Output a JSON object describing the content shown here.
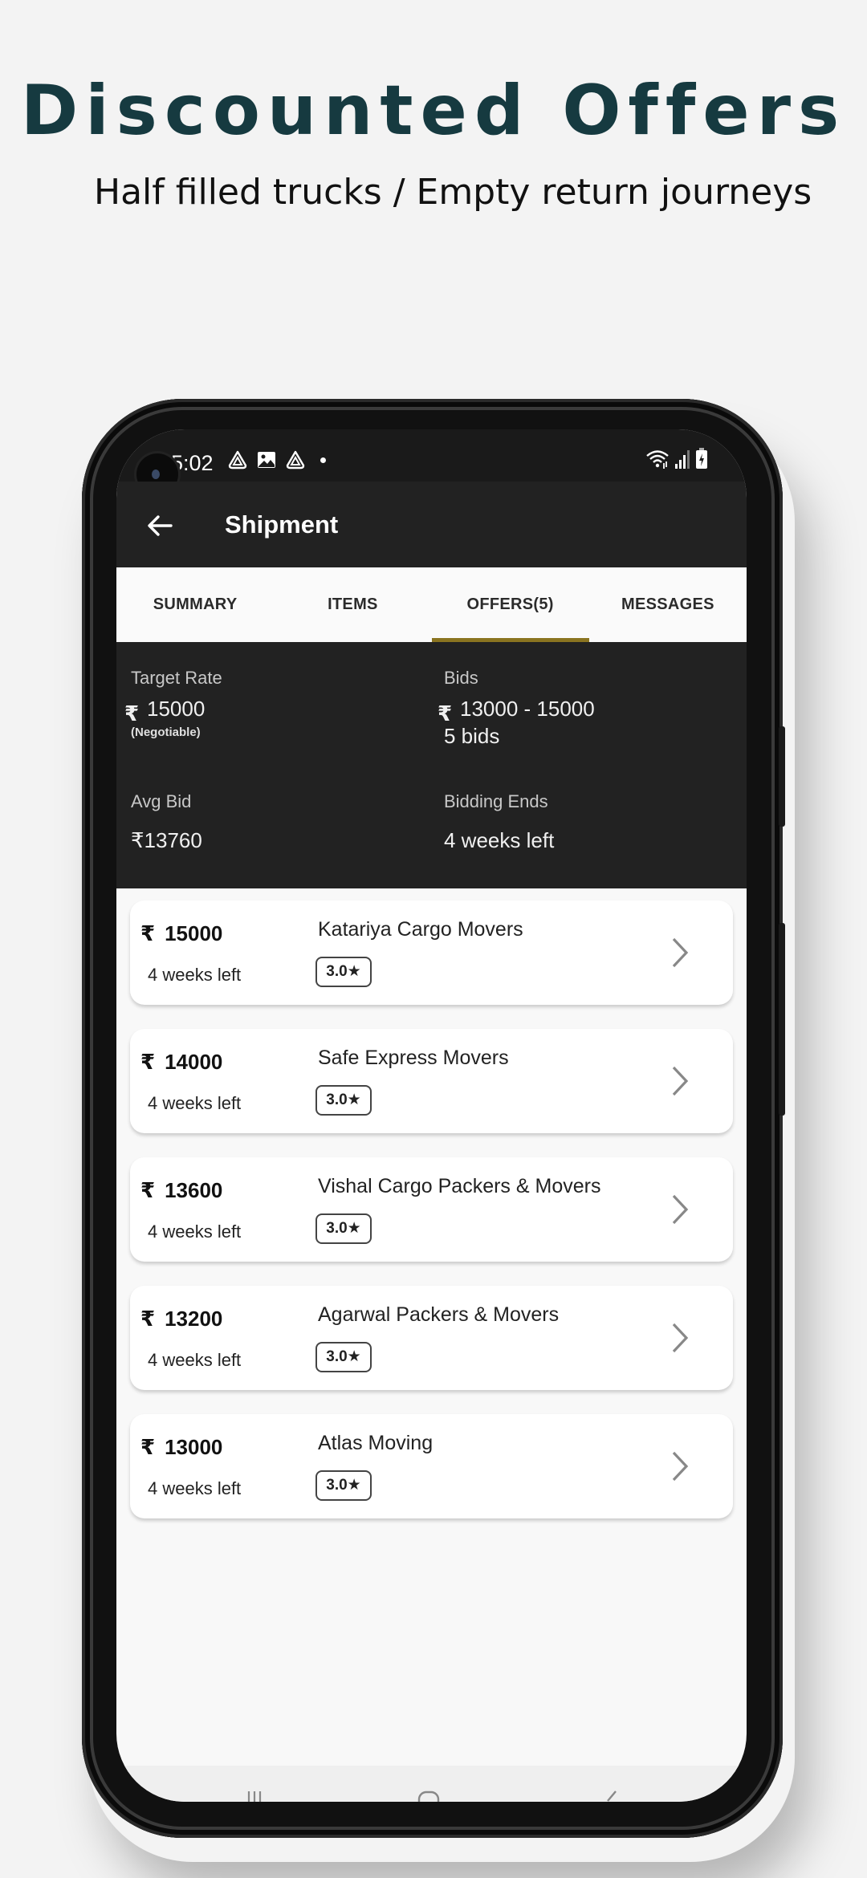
{
  "promo": {
    "title": "Discounted Offers",
    "subtitle": "Half filled trucks / Empty return journeys",
    "title_color": "#163a40"
  },
  "status_bar": {
    "time": "5:02",
    "left_icons": [
      "drive-icon",
      "image-icon",
      "drive-icon",
      "dot-icon"
    ],
    "right_icons": [
      "wifi-icon",
      "signal-icon",
      "battery-charging-icon"
    ]
  },
  "app_bar": {
    "back_icon": "arrow-left-icon",
    "title": "Shipment"
  },
  "tabs": [
    {
      "label": "SUMMARY",
      "active": false
    },
    {
      "label": "ITEMS",
      "active": false
    },
    {
      "label": "OFFERS(5)",
      "active": true
    },
    {
      "label": "MESSAGES",
      "active": false
    }
  ],
  "accent_color": "#8a7420",
  "stats": {
    "target_rate": {
      "label": "Target Rate",
      "currency": "₹",
      "value": "15000",
      "note": "(Negotiable)"
    },
    "bids": {
      "label": "Bids",
      "currency": "₹",
      "range": "13000 - 15000",
      "count": "5 bids"
    },
    "avg_bid": {
      "label": "Avg Bid",
      "value": "₹13760"
    },
    "bidding_ends": {
      "label": "Bidding Ends",
      "value": "4 weeks left"
    }
  },
  "offers": [
    {
      "currency": "₹",
      "price": "15000",
      "time_left": "4 weeks left",
      "company": "Katariya Cargo Movers",
      "rating": "3.0★"
    },
    {
      "currency": "₹",
      "price": "14000",
      "time_left": "4 weeks left",
      "company": "Safe Express Movers",
      "rating": "3.0★"
    },
    {
      "currency": "₹",
      "price": "13600",
      "time_left": "4 weeks left",
      "company": "Vishal Cargo Packers & Movers",
      "rating": "3.0★"
    },
    {
      "currency": "₹",
      "price": "13200",
      "time_left": "4 weeks left",
      "company": "Agarwal Packers & Movers",
      "rating": "3.0★"
    },
    {
      "currency": "₹",
      "price": "13000",
      "time_left": "4 weeks left",
      "company": "Atlas Moving",
      "rating": "3.0★"
    }
  ],
  "nav_bar": {
    "icons": [
      "recents-icon",
      "home-icon",
      "back-icon"
    ]
  }
}
